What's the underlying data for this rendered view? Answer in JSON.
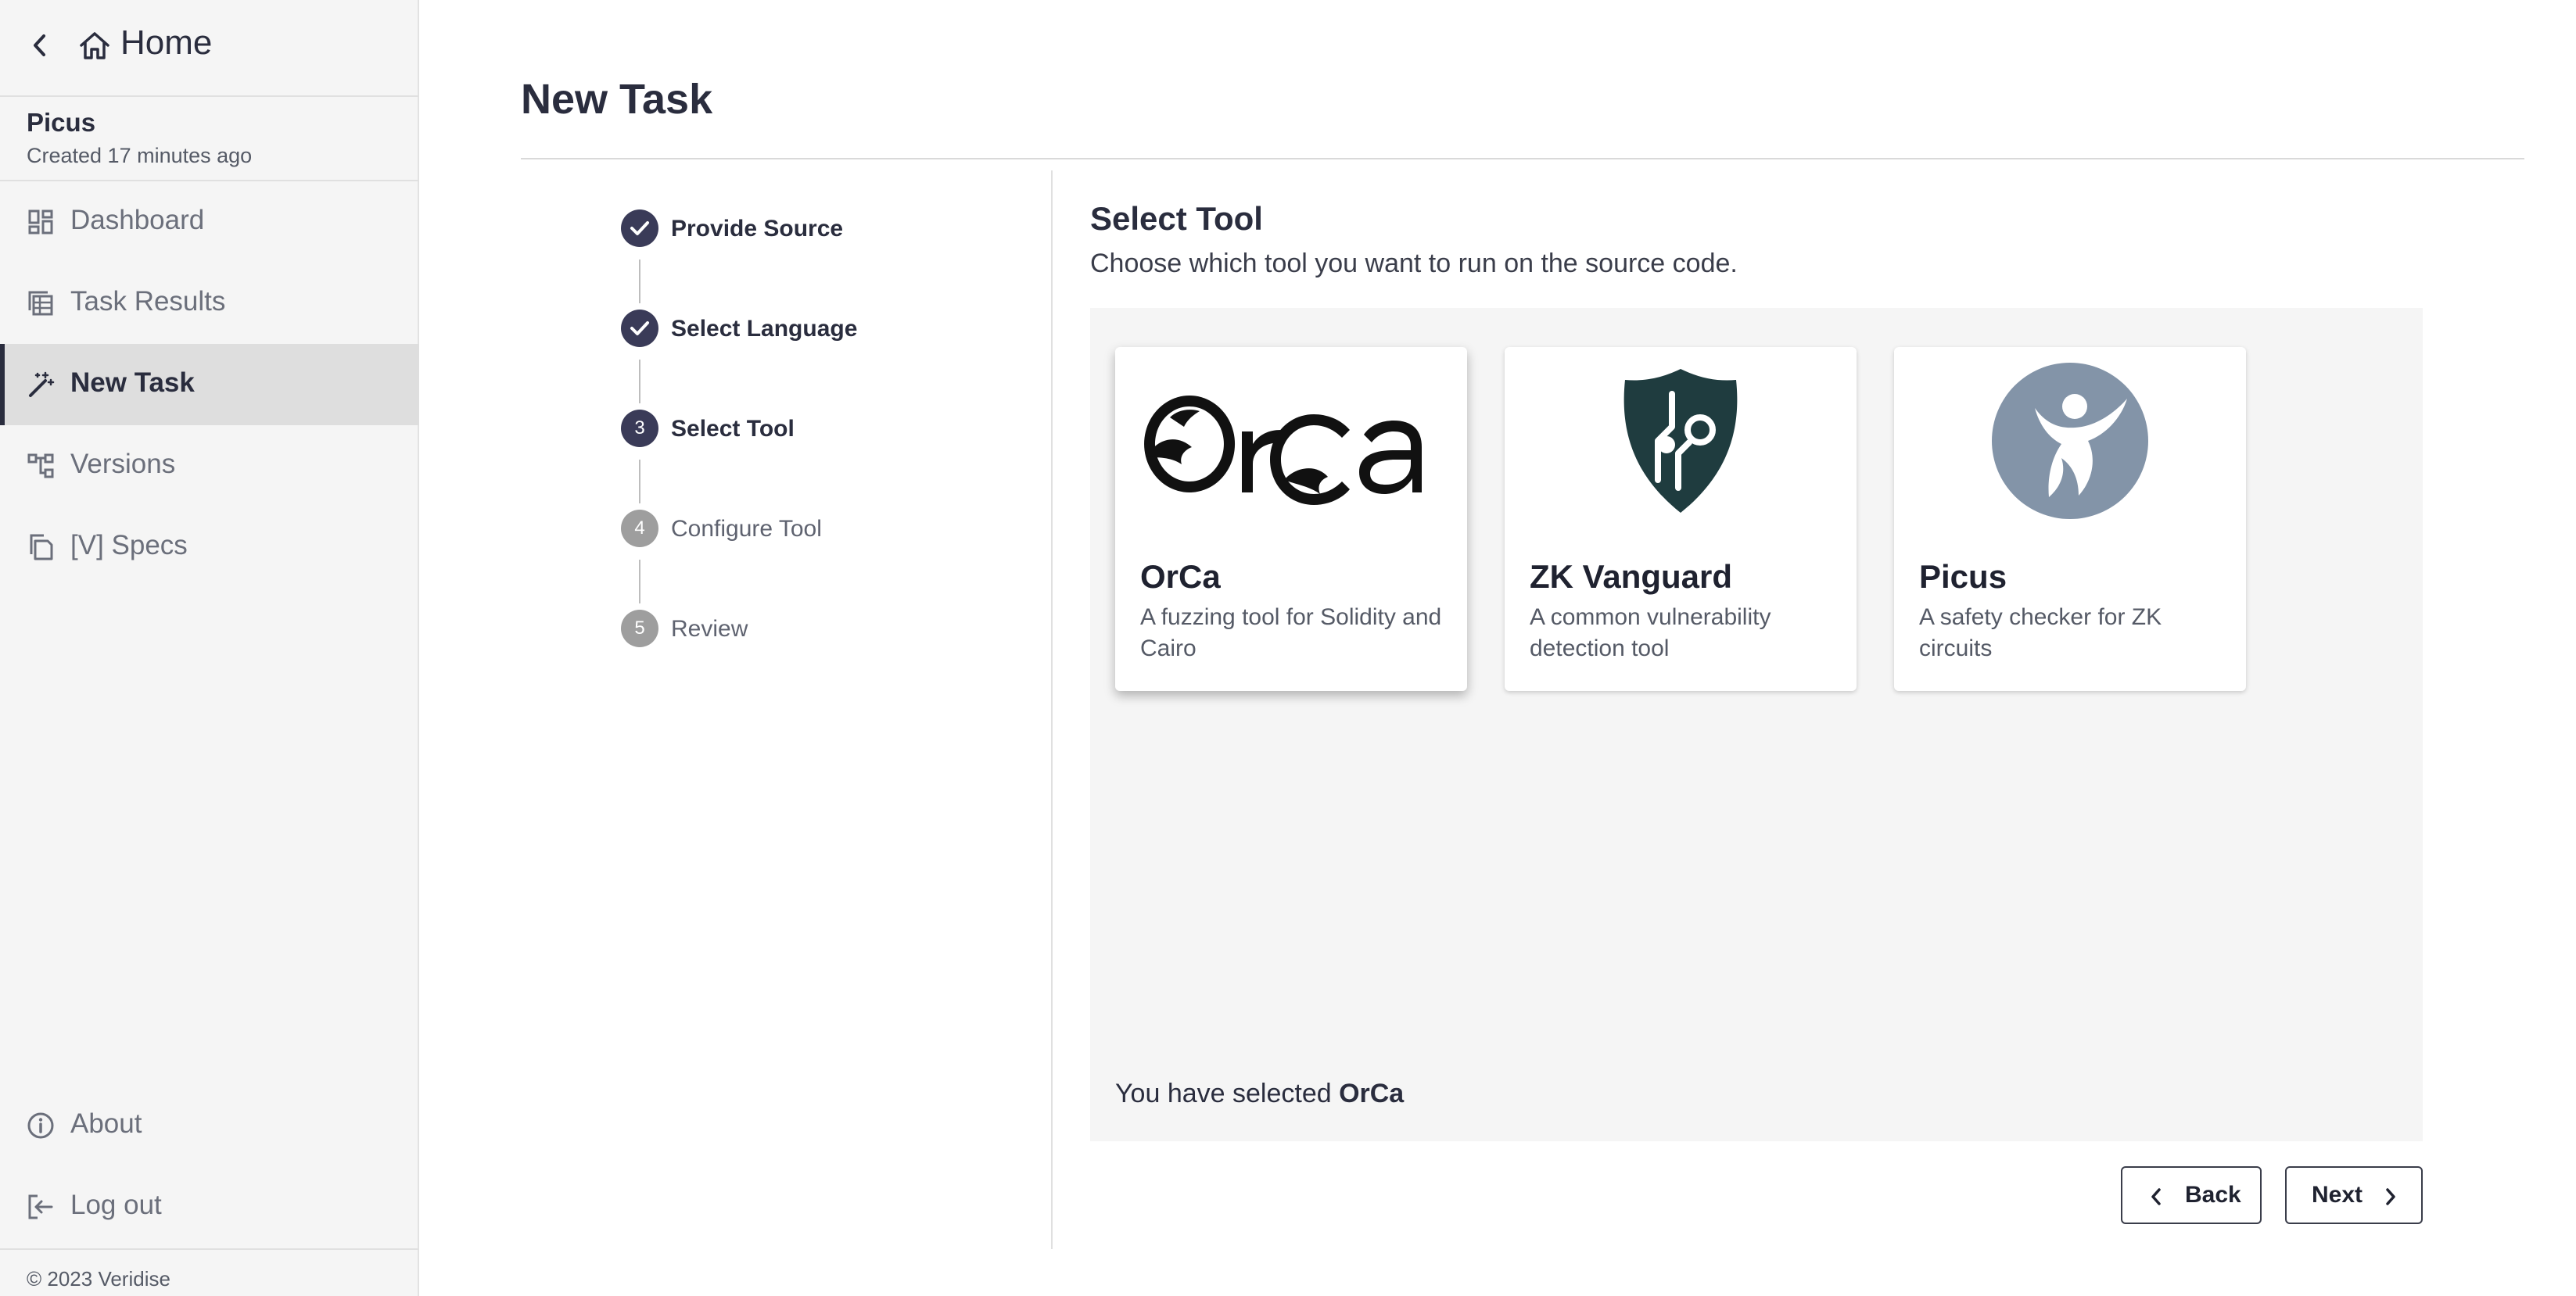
{
  "sidebar": {
    "home_label": "Home",
    "project": {
      "name": "Picus",
      "created": "Created 17 minutes ago"
    },
    "nav": [
      {
        "label": "Dashboard",
        "icon": "dashboard-icon"
      },
      {
        "label": "Task Results",
        "icon": "task-results-icon"
      },
      {
        "label": "New Task",
        "icon": "magic-wand-icon",
        "active": true
      },
      {
        "label": "Versions",
        "icon": "versions-icon"
      },
      {
        "label": "[V] Specs",
        "icon": "specs-icon"
      }
    ],
    "bottom": [
      {
        "label": "About",
        "icon": "info-icon"
      },
      {
        "label": "Log out",
        "icon": "logout-icon"
      }
    ],
    "copyright": "© 2023 Veridise"
  },
  "main": {
    "title": "New Task",
    "steps": [
      {
        "number": "1",
        "label": "Provide Source",
        "state": "done"
      },
      {
        "number": "2",
        "label": "Select Language",
        "state": "done"
      },
      {
        "number": "3",
        "label": "Select Tool",
        "state": "current"
      },
      {
        "number": "4",
        "label": "Configure Tool",
        "state": "pending"
      },
      {
        "number": "5",
        "label": "Review",
        "state": "pending"
      }
    ],
    "section_title": "Select Tool",
    "section_subtitle": "Choose which tool you want to run on the source code.",
    "tools": [
      {
        "name": "OrCa",
        "description": "A fuzzing tool for Solidity and Cairo",
        "logo": "orca-logo",
        "selected": true
      },
      {
        "name": "ZK Vanguard",
        "description": "A common vulnerability detection tool",
        "logo": "zk-vanguard-shield-logo",
        "selected": false
      },
      {
        "name": "Picus",
        "description": "A safety checker for ZK circuits",
        "logo": "picus-figure-logo",
        "selected": false
      }
    ],
    "selected_prefix": "You have selected ",
    "selected_tool": "OrCa",
    "buttons": {
      "back": "Back",
      "next": "Next"
    }
  },
  "colors": {
    "primary": "#2a2d3e",
    "step_active": "#3a3b58",
    "step_pending": "#9e9e9e",
    "sidebar_bg": "#f5f5f5",
    "sidebar_active": "#dedede",
    "zk_vanguard": "#1f3c3f",
    "picus": "#8394a8"
  }
}
